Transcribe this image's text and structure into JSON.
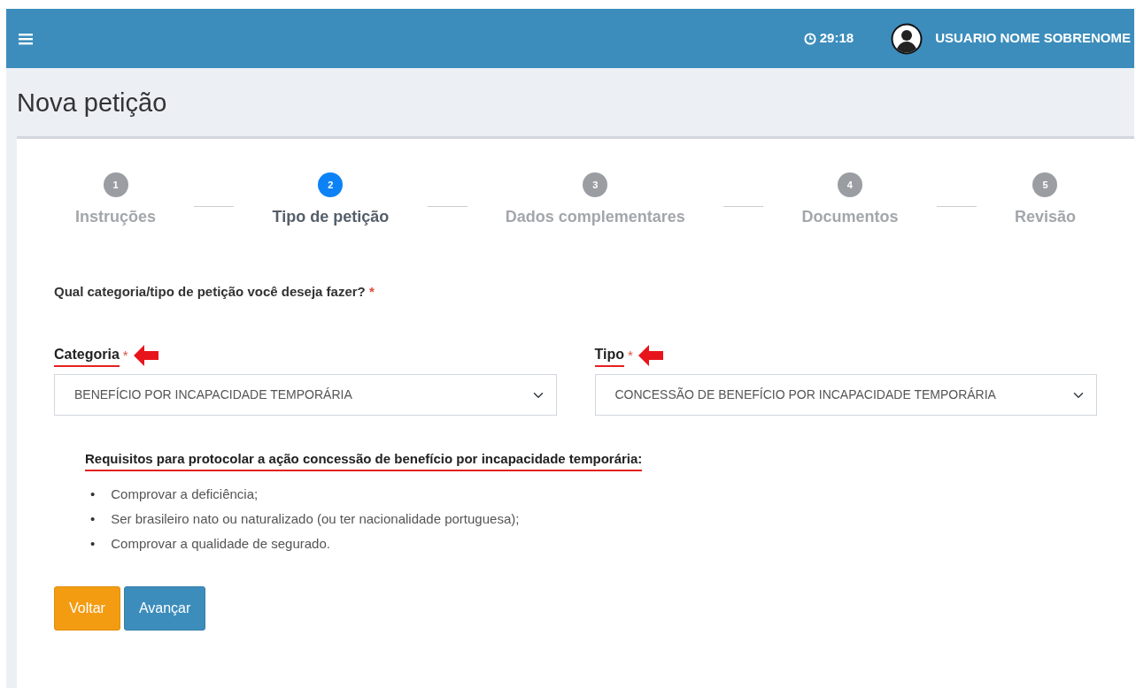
{
  "header": {
    "clock": "29:18",
    "user": "USUARIO NOME SOBRENOME"
  },
  "page_title": "Nova petição",
  "steps": [
    {
      "number": "1",
      "label": "Instruções",
      "selected": false
    },
    {
      "number": "2",
      "label": "Tipo de petição",
      "selected": true
    },
    {
      "number": "3",
      "label": "Dados complementares",
      "selected": false
    },
    {
      "number": "4",
      "label": "Documentos",
      "selected": false
    },
    {
      "number": "5",
      "label": "Revisão",
      "selected": false
    }
  ],
  "question": {
    "text": "Qual categoria/tipo de petição você deseja fazer?",
    "required_mark": "*"
  },
  "fields": [
    {
      "label": "Categoria",
      "required_mark": "*",
      "value": "BENEFÍCIO POR INCAPACIDADE TEMPORÁRIA",
      "highlighted": true
    },
    {
      "label": "Tipo",
      "required_mark": "*",
      "value": "CONCESSÃO DE BENEFÍCIO POR INCAPACIDADE TEMPORÁRIA",
      "highlighted": true
    }
  ],
  "requirements": {
    "title": "Requisitos para protocolar a ação concessão de benefício por incapacidade temporária:",
    "highlighted": true,
    "items": [
      {
        "bullet": "•",
        "text": "Comprovar a deficiência;"
      },
      {
        "bullet": "•",
        "text": "Ser brasileiro nato ou naturalizado (ou ter nacionalidade portuguesa);"
      },
      {
        "bullet": "•",
        "text": "Comprovar a qualidade de segurado."
      }
    ]
  },
  "buttons": [
    {
      "label": "Voltar",
      "kind": "back"
    },
    {
      "label": "Avançar",
      "kind": "next"
    }
  ]
}
